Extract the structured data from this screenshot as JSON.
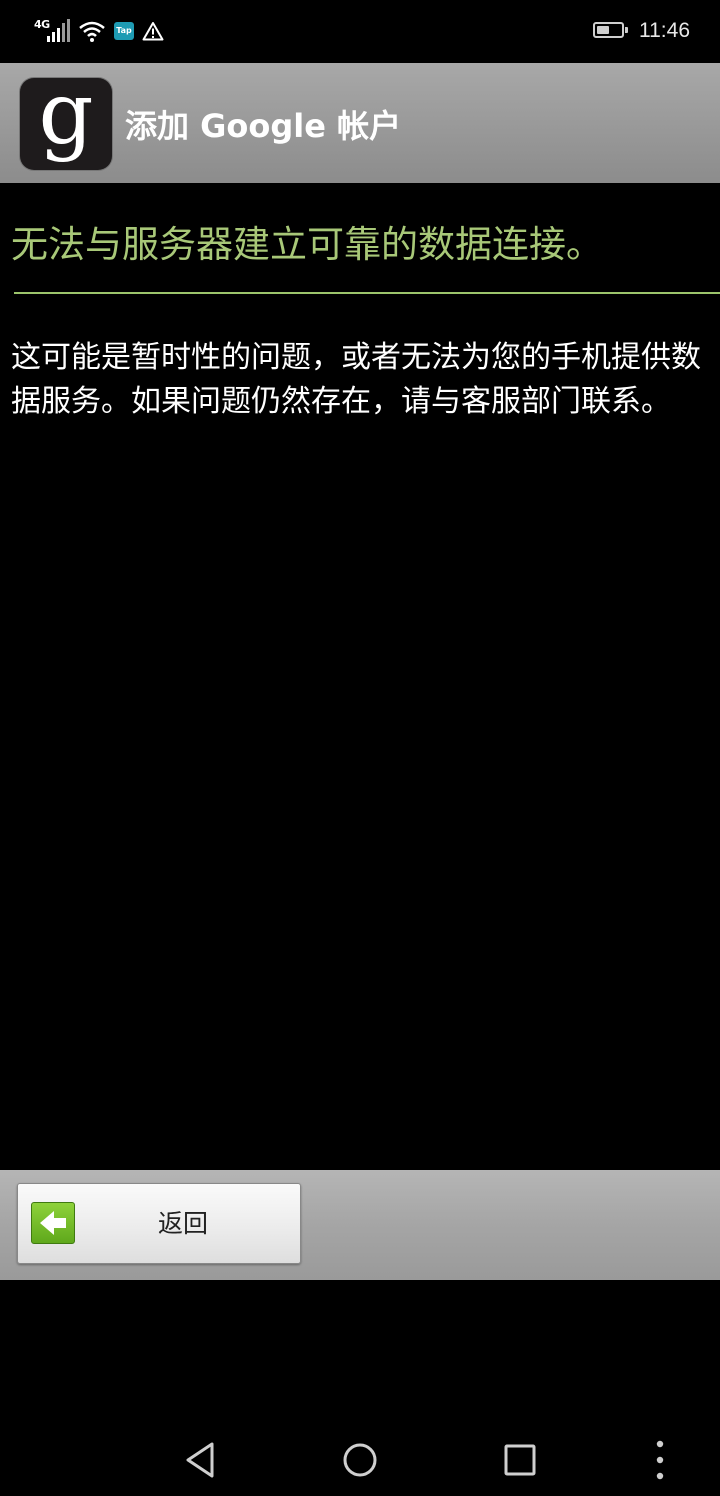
{
  "status_bar": {
    "network": "4G",
    "notification_badge": "Tap",
    "time": "11:46",
    "battery_level_percent": 50
  },
  "header": {
    "app_icon_letter": "g",
    "title": "添加 Google 帐户"
  },
  "main": {
    "heading": "无法与服务器建立可靠的数据连接。",
    "body": "这可能是暂时性的问题，或者无法为您的手机提供数据服务。如果问题仍然存在，请与客服部门联系。"
  },
  "footer": {
    "back_label": "返回"
  },
  "colors": {
    "heading": "#a8c878",
    "divider": "#9cc46b",
    "back_icon": "#6bb522"
  },
  "icons": {
    "status": [
      "signal-icon",
      "wifi-icon",
      "tap-icon",
      "warning-icon",
      "battery-icon"
    ],
    "navigation": [
      "back-triangle-icon",
      "home-circle-icon",
      "recents-square-icon",
      "more-dots-icon"
    ]
  }
}
